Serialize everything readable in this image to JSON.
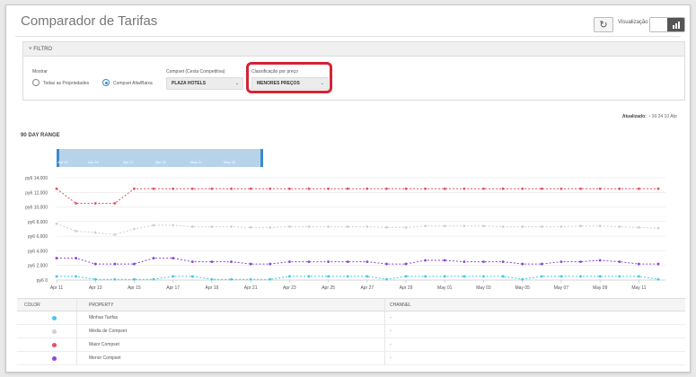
{
  "header": {
    "title": "Comparador de Tarifas",
    "visualizacao_label": "Visualização"
  },
  "filter": {
    "title": "FILTRO",
    "mostrar": {
      "label": "Mostrar",
      "options": [
        "Todas as Propriedades",
        "Compset Alta/Baixa"
      ],
      "selected": "Compset Alta/Baixa"
    },
    "compset": {
      "label": "Compset (Cesta Competitiva)",
      "value": "PLAZA HOTELS"
    },
    "classificacao": {
      "label": "Classificação por preço",
      "value": "MENORES PREÇOS"
    }
  },
  "updated": {
    "label": "Atualizado:",
    "value": "16:24 10 Abr"
  },
  "range": {
    "title": "90 DAY RANGE",
    "navigator_labels": [
      "Apr 11",
      "Apr 16",
      "Apr 21",
      "Apr 26",
      "May 01",
      "May 06"
    ]
  },
  "chart_data": {
    "type": "line",
    "x": [
      "Apr 11",
      "Apr 12",
      "Apr 13",
      "Apr 14",
      "Apr 15",
      "Apr 16",
      "Apr 17",
      "Apr 18",
      "Apr 19",
      "Apr 20",
      "Apr 21",
      "Apr 22",
      "Apr 23",
      "Apr 24",
      "Apr 25",
      "Apr 26",
      "Apr 27",
      "Apr 28",
      "Apr 29",
      "Apr 30",
      "May 01",
      "May 02",
      "May 03",
      "May 04",
      "May 05",
      "May 06",
      "May 07",
      "May 08",
      "May 09",
      "May 10",
      "May 11",
      "May 12"
    ],
    "x_tick_labels": [
      "Apr 11",
      "Apr 13",
      "Apr 15",
      "Apr 17",
      "Apr 19",
      "Apr 21",
      "Apr 23",
      "Apr 25",
      "Apr 27",
      "Apr 29",
      "May 01",
      "May 03",
      "May 05",
      "May 07",
      "May 09",
      "May 11"
    ],
    "y_tick_labels": [
      "py6 0",
      "py6 2,000",
      "py6 4,000",
      "py6 6,000",
      "py6 8,000",
      "py6 10,000",
      "py6 12,000",
      "py6 14,000"
    ],
    "ylim": [
      0,
      14000
    ],
    "grid": true,
    "series": [
      {
        "name": "Minhas Tarifas",
        "color": "#44c8e0",
        "values": [
          500,
          500,
          100,
          100,
          100,
          100,
          500,
          500,
          100,
          100,
          100,
          100,
          500,
          500,
          500,
          500,
          500,
          100,
          500,
          500,
          500,
          500,
          500,
          500,
          100,
          500,
          500,
          500,
          500,
          500,
          500,
          100
        ]
      },
      {
        "name": "Média de Compset",
        "color": "#d0d0d0",
        "values": [
          7700,
          6700,
          6500,
          6200,
          7000,
          7500,
          7500,
          7300,
          7300,
          7300,
          7200,
          7200,
          7300,
          7300,
          7300,
          7300,
          7300,
          7200,
          7200,
          7400,
          7400,
          7400,
          7400,
          7300,
          7300,
          7300,
          7300,
          7400,
          7400,
          7300,
          7200,
          7100
        ]
      },
      {
        "name": "Maior Compset",
        "color": "#e8505b",
        "values": [
          12500,
          10500,
          10500,
          10500,
          12500,
          12500,
          12500,
          12500,
          12500,
          12500,
          12500,
          12500,
          12500,
          12500,
          12500,
          12500,
          12500,
          12500,
          12500,
          12500,
          12500,
          12500,
          12500,
          12500,
          12500,
          12500,
          12500,
          12500,
          12500,
          12500,
          12500,
          12500
        ]
      },
      {
        "name": "Menor Compset",
        "color": "#8e44d9",
        "values": [
          3000,
          3000,
          2200,
          2200,
          2200,
          3000,
          3000,
          2500,
          2500,
          2500,
          2200,
          2200,
          2500,
          2500,
          2500,
          2500,
          2500,
          2200,
          2200,
          2700,
          2700,
          2500,
          2500,
          2500,
          2200,
          2200,
          2500,
          2500,
          2700,
          2500,
          2200,
          2200
        ]
      }
    ]
  },
  "table": {
    "headers": [
      "COLOR",
      "PROPERTY",
      "CHANNEL"
    ],
    "rows": [
      {
        "color": "#44c8e0",
        "property": "Minhas Tarifas",
        "channel": "-"
      },
      {
        "color": "#d0d0d0",
        "property": "Média de Compset",
        "channel": "-"
      },
      {
        "color": "#e8505b",
        "property": "Maior Compset",
        "channel": "-"
      },
      {
        "color": "#8e44d9",
        "property": "Menor Compset",
        "channel": "-"
      }
    ]
  }
}
